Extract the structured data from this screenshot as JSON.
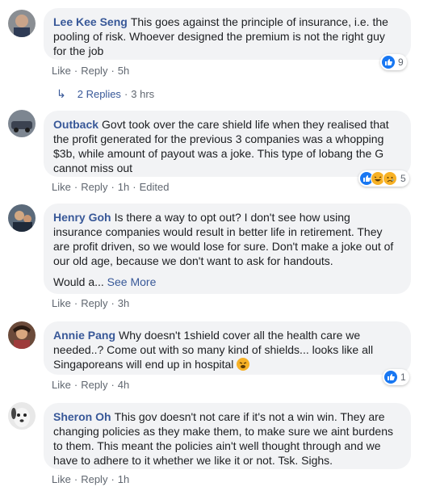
{
  "comments": [
    {
      "author": "Lee Kee Seng",
      "text": "This goes against the principle of insurance, i.e. the pooling of risk. Whoever designed the premium is not the right guy for the job",
      "actions": {
        "like": "Like",
        "reply": "Reply",
        "time": "5h"
      },
      "reactions": {
        "count": "9",
        "types": [
          "like"
        ]
      },
      "replies": {
        "label": "2 Replies",
        "time": "3 hrs"
      }
    },
    {
      "author": "Outback",
      "text": "Govt took over the care shield life when they realised that the profit generated for the previous 3 companies was a whopping $3b, while amount of payout was a joke. This type of lobang the G cannot miss out",
      "actions": {
        "like": "Like",
        "reply": "Reply",
        "time": "1h",
        "edited": "Edited"
      },
      "reactions": {
        "count": "5",
        "types": [
          "like",
          "haha",
          "sad"
        ]
      }
    },
    {
      "author": "Henry Goh",
      "text": "Is there a way to opt out? I don't see how using insurance companies would result in better life in retirement. They are profit driven, so we would lose for sure. Don't make a joke out of our old age, because we don't want to ask for handouts.",
      "more_prefix": "Would a...",
      "see_more": "See More",
      "actions": {
        "like": "Like",
        "reply": "Reply",
        "time": "3h"
      }
    },
    {
      "author": "Annie Pang",
      "text": "Why doesn't 1shield cover all the health care we needed..? Come out with so many kind of shields... looks like all Singaporeans will end up in hospital",
      "actions": {
        "like": "Like",
        "reply": "Reply",
        "time": "4h"
      },
      "reactions": {
        "count": "1",
        "types": [
          "like"
        ]
      }
    },
    {
      "author": "Sheron Oh",
      "text": "This gov doesn't not care if it's not a win win. They are changing policies as they make them, to make sure we aint burdens to them. This meant the policies ain't well thought through and we have to adhere to it whether we like it or not. Tsk. Sighs.",
      "actions": {
        "like": "Like",
        "reply": "Reply",
        "time": "1h"
      }
    }
  ],
  "colors": {
    "name": "#385898",
    "bubble": "#f2f3f5",
    "meta": "#606770",
    "like": "#1877f2",
    "emoji": "#f7b125"
  }
}
